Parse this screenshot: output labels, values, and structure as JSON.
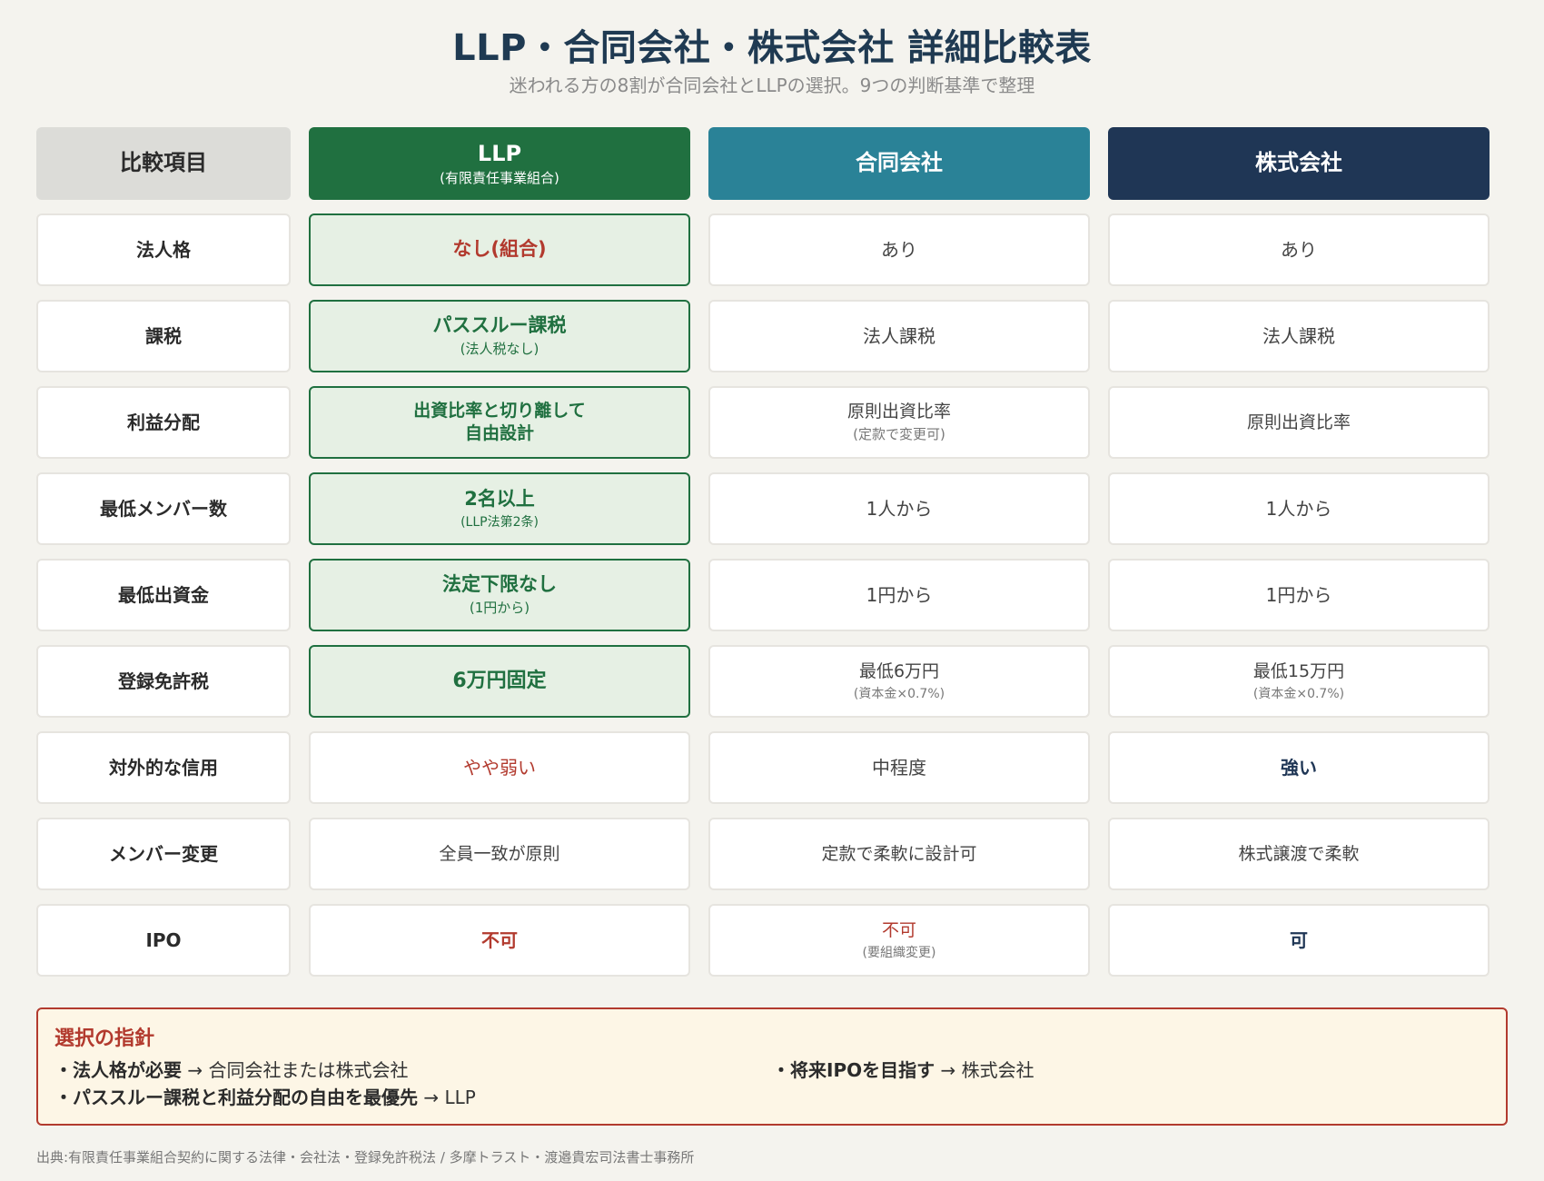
{
  "header": {
    "title": "LLP・合同会社・株式会社 詳細比較表",
    "subtitle": "迷われる方の8割が合同会社とLLPの選択。9つの判断基準で整理"
  },
  "columns": {
    "item": "比較項目",
    "llp": {
      "name": "LLP",
      "sub": "(有限責任事業組合)"
    },
    "gk": {
      "name": "合同会社"
    },
    "kk": {
      "name": "株式会社"
    }
  },
  "rows": [
    {
      "label": "法人格",
      "llp": {
        "main": "なし(組合)"
      },
      "gk": {
        "main": "あり"
      },
      "kk": {
        "main": "あり"
      }
    },
    {
      "label": "課税",
      "llp": {
        "main": "パススルー課税",
        "sub": "(法人税なし)"
      },
      "gk": {
        "main": "法人課税"
      },
      "kk": {
        "main": "法人課税"
      }
    },
    {
      "label": "利益分配",
      "llp": {
        "main": "出資比率と切り離して",
        "main2": "自由設計"
      },
      "gk": {
        "main": "原則出資比率",
        "sub": "(定款で変更可)"
      },
      "kk": {
        "main": "原則出資比率"
      }
    },
    {
      "label": "最低メンバー数",
      "llp": {
        "main": "2名以上",
        "sub": "(LLP法第2条)"
      },
      "gk": {
        "main": "1人から"
      },
      "kk": {
        "main": "1人から"
      }
    },
    {
      "label": "最低出資金",
      "llp": {
        "main": "法定下限なし",
        "sub": "(1円から)"
      },
      "gk": {
        "main": "1円から"
      },
      "kk": {
        "main": "1円から"
      }
    },
    {
      "label": "登録免許税",
      "llp": {
        "main": "6万円固定"
      },
      "gk": {
        "main": "最低6万円",
        "sub": "(資本金×0.7%)"
      },
      "kk": {
        "main": "最低15万円",
        "sub": "(資本金×0.7%)"
      }
    },
    {
      "label": "対外的な信用",
      "llp": {
        "main": "やや弱い"
      },
      "gk": {
        "main": "中程度"
      },
      "kk": {
        "main": "強い"
      }
    },
    {
      "label": "メンバー変更",
      "llp": {
        "main": "全員一致が原則"
      },
      "gk": {
        "main": "定款で柔軟に設計可"
      },
      "kk": {
        "main": "株式譲渡で柔軟"
      }
    },
    {
      "label": "IPO",
      "llp": {
        "main": "不可"
      },
      "gk": {
        "main": "不可",
        "sub": "(要組織変更)"
      },
      "kk": {
        "main": "可"
      }
    }
  ],
  "guide": {
    "title": "選択の指針",
    "items": [
      {
        "bold": "・法人格が必要",
        "rest": " → 合同会社または株式会社"
      },
      {
        "bold": "・パススルー課税と利益分配の自由を最優先",
        "rest": " → LLP"
      },
      {
        "bold": "・将来IPOを目指す",
        "rest": " → 株式会社"
      }
    ]
  },
  "footer": "出典:有限責任事業組合契約に関する法律・会社法・登録免許税法 / 多摩トラスト・渡邉貴宏司法書士事務所",
  "colors": {
    "llp_green": "#207040",
    "gk_teal": "#2a8297",
    "kk_navy": "#1f3655",
    "warning_red": "#b23a2e",
    "highlight_bg": "#e6f0e4",
    "guide_bg": "#fdf6e6"
  }
}
